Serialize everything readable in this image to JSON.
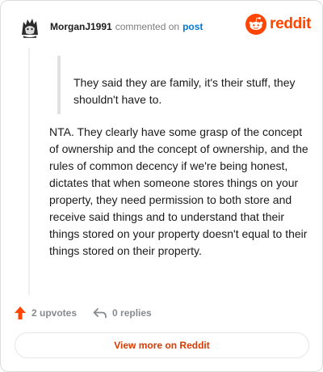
{
  "header": {
    "username": "MorganJ1991",
    "action_text": "commented on",
    "post_link": "post",
    "brand": "reddit"
  },
  "quote": {
    "text": "They said they are family, it's their stuff, they shouldn't have to."
  },
  "comment": {
    "text": "NTA. They clearly have some grasp of the concept of ownership and the concept of ownership, and the rules of common decency if we're being honest, dictates that when someone stores things on your property, they need permission to both store and receive said things and to understand that their things stored on your property doesn't equal to their things stored on their property."
  },
  "actions": {
    "upvotes": "2 upvotes",
    "replies": "0 replies"
  },
  "footer": {
    "view_more": "View more on Reddit"
  },
  "colors": {
    "brand_orange": "#ff4500",
    "link_blue": "#0079d3",
    "view_more_text": "#d93a00",
    "muted_gray": "#878a8c"
  },
  "icons": {
    "avatar": "user-avatar",
    "brand": "reddit-snoo-icon",
    "upvote": "upvote-arrow-icon",
    "reply": "reply-arrow-icon"
  }
}
